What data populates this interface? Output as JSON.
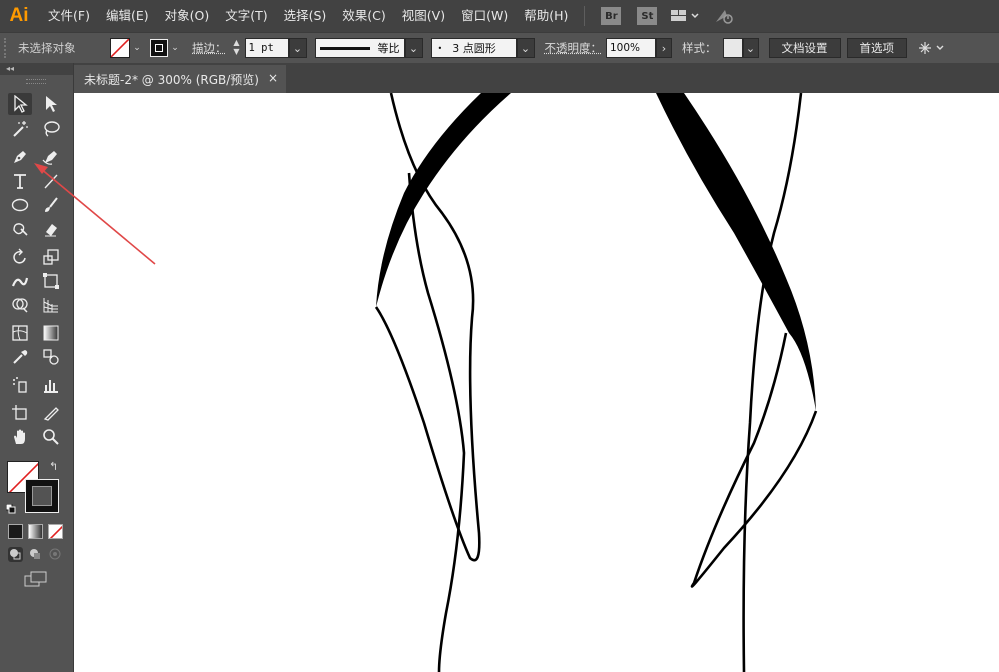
{
  "app": {
    "logo": "Ai"
  },
  "menu": [
    "文件(F)",
    "编辑(E)",
    "对象(O)",
    "文字(T)",
    "选择(S)",
    "效果(C)",
    "视图(V)",
    "窗口(W)",
    "帮助(H)"
  ],
  "bridge_badges": [
    "Br",
    "St"
  ],
  "control": {
    "selection_status": "未选择对象",
    "stroke_label": "描边：",
    "stroke_value": "1 pt",
    "profile_label": "等比",
    "brush_label": "3 点圆形",
    "opacity_label": "不透明度：",
    "opacity_value": "100%",
    "style_label": "样式：",
    "doc_setup": "文档设置",
    "preferences": "首选项"
  },
  "document": {
    "tab_title": "未标题-2* @ 300% (RGB/预览)",
    "close": "×"
  },
  "colors": {
    "accent_logo": "#ff9a00",
    "arrow": "#e04848",
    "canvas": "#ffffff",
    "ui_dark": "#424242",
    "ui_mid": "#535353"
  },
  "tools": [
    "selection-tool",
    "direct-selection-tool",
    "magic-wand-tool",
    "lasso-tool",
    "pen-tool",
    "curvature-tool",
    "type-tool",
    "line-segment-tool",
    "ellipse-tool",
    "paintbrush-tool",
    "shaper-tool",
    "eraser-tool",
    "rotate-tool",
    "scale-tool",
    "width-tool",
    "free-transform-tool",
    "shape-builder-tool",
    "perspective-grid-tool",
    "mesh-tool",
    "gradient-tool",
    "eyedropper-tool",
    "blend-tool",
    "symbol-sprayer-tool",
    "column-graph-tool",
    "artboard-tool",
    "slice-tool",
    "hand-tool",
    "zoom-tool"
  ]
}
